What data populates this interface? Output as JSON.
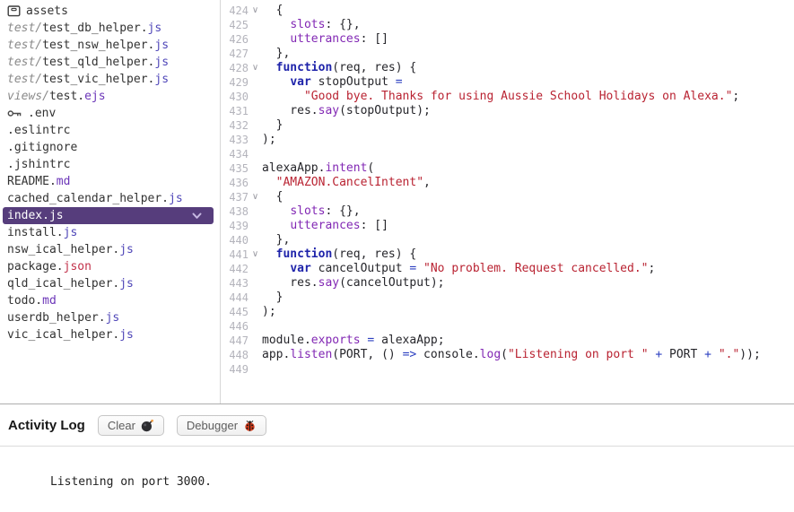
{
  "colors": {
    "selection_bg": "#563d7c",
    "keyword": "#1e23aa",
    "property": "#8228b4",
    "string": "#b92332",
    "operator": "#2b3fc0",
    "ext_js": "#4f46b8",
    "ext_md": "#6b35b8",
    "ext_ejs": "#6b35b8",
    "ext_json": "#c2314a",
    "dir_gray": "#8a8a8a"
  },
  "sidebar": {
    "files": [
      {
        "id": "assets",
        "icon": "archive-box-icon",
        "segments": [
          {
            "t": "assets",
            "c": "name"
          }
        ]
      },
      {
        "id": "test-test_db_helper-js",
        "segments": [
          {
            "t": "test/",
            "c": "dir"
          },
          {
            "t": "test_db_helper.",
            "c": "name"
          },
          {
            "t": "js",
            "c": "ext-js"
          }
        ]
      },
      {
        "id": "test-test_nsw_helper-js",
        "segments": [
          {
            "t": "test/",
            "c": "dir"
          },
          {
            "t": "test_nsw_helper.",
            "c": "name"
          },
          {
            "t": "js",
            "c": "ext-js"
          }
        ]
      },
      {
        "id": "test-test_qld_helper-js",
        "segments": [
          {
            "t": "test/",
            "c": "dir"
          },
          {
            "t": "test_qld_helper.",
            "c": "name"
          },
          {
            "t": "js",
            "c": "ext-js"
          }
        ]
      },
      {
        "id": "test-test_vic_helper-js",
        "segments": [
          {
            "t": "test/",
            "c": "dir"
          },
          {
            "t": "test_vic_helper.",
            "c": "name"
          },
          {
            "t": "js",
            "c": "ext-js"
          }
        ]
      },
      {
        "id": "views-test-ejs",
        "segments": [
          {
            "t": "views/",
            "c": "dir"
          },
          {
            "t": "test.",
            "c": "name"
          },
          {
            "t": "ejs",
            "c": "ext-ejs"
          }
        ]
      },
      {
        "id": "env",
        "icon": "key-icon",
        "segments": [
          {
            "t": ".env",
            "c": "name"
          }
        ]
      },
      {
        "id": "eslintrc",
        "segments": [
          {
            "t": ".eslintrc",
            "c": "name"
          }
        ]
      },
      {
        "id": "gitignore",
        "segments": [
          {
            "t": ".gitignore",
            "c": "name"
          }
        ]
      },
      {
        "id": "jshintrc",
        "segments": [
          {
            "t": ".jshintrc",
            "c": "name"
          }
        ]
      },
      {
        "id": "readme-md",
        "segments": [
          {
            "t": "README.",
            "c": "name"
          },
          {
            "t": "md",
            "c": "ext-md"
          }
        ]
      },
      {
        "id": "cached_calendar_helper-js",
        "segments": [
          {
            "t": "cached_calendar_helper.",
            "c": "name"
          },
          {
            "t": "js",
            "c": "ext-js"
          }
        ]
      },
      {
        "id": "index-js",
        "selected": true,
        "segments": [
          {
            "t": "index.",
            "c": "name"
          },
          {
            "t": "js",
            "c": "ext-js"
          }
        ]
      },
      {
        "id": "install-js",
        "segments": [
          {
            "t": "install.",
            "c": "name"
          },
          {
            "t": "js",
            "c": "ext-js"
          }
        ]
      },
      {
        "id": "nsw_ical_helper-js",
        "segments": [
          {
            "t": "nsw_ical_helper.",
            "c": "name"
          },
          {
            "t": "js",
            "c": "ext-js"
          }
        ]
      },
      {
        "id": "package-json",
        "segments": [
          {
            "t": "package.",
            "c": "name"
          },
          {
            "t": "json",
            "c": "ext-json"
          }
        ]
      },
      {
        "id": "qld_ical_helper-js",
        "segments": [
          {
            "t": "qld_ical_helper.",
            "c": "name"
          },
          {
            "t": "js",
            "c": "ext-js"
          }
        ]
      },
      {
        "id": "todo-md",
        "segments": [
          {
            "t": "todo.",
            "c": "name"
          },
          {
            "t": "md",
            "c": "ext-md"
          }
        ]
      },
      {
        "id": "userdb_helper-js",
        "segments": [
          {
            "t": "userdb_helper.",
            "c": "name"
          },
          {
            "t": "js",
            "c": "ext-js"
          }
        ]
      },
      {
        "id": "vic_ical_helper-js",
        "segments": [
          {
            "t": "vic_ical_helper.",
            "c": "name"
          },
          {
            "t": "js",
            "c": "ext-js"
          }
        ]
      }
    ]
  },
  "editor": {
    "lines": [
      {
        "n": 424,
        "fold": true,
        "tokens": [
          {
            "t": "  {",
            "c": "plain"
          }
        ]
      },
      {
        "n": 425,
        "fold": false,
        "tokens": [
          {
            "t": "    ",
            "c": "plain"
          },
          {
            "t": "slots",
            "c": "property"
          },
          {
            "t": ": {},",
            "c": "plain"
          }
        ]
      },
      {
        "n": 426,
        "fold": false,
        "tokens": [
          {
            "t": "    ",
            "c": "plain"
          },
          {
            "t": "utterances",
            "c": "property"
          },
          {
            "t": ": []",
            "c": "plain"
          }
        ]
      },
      {
        "n": 427,
        "fold": false,
        "tokens": [
          {
            "t": "  },",
            "c": "plain"
          }
        ]
      },
      {
        "n": 428,
        "fold": true,
        "tokens": [
          {
            "t": "  ",
            "c": "plain"
          },
          {
            "t": "function",
            "c": "keyword"
          },
          {
            "t": "(req, res) {",
            "c": "plain"
          }
        ]
      },
      {
        "n": 429,
        "fold": false,
        "tokens": [
          {
            "t": "    ",
            "c": "plain"
          },
          {
            "t": "var",
            "c": "keyword"
          },
          {
            "t": " stopOutput ",
            "c": "plain"
          },
          {
            "t": "=",
            "c": "operator"
          }
        ]
      },
      {
        "n": 430,
        "fold": false,
        "tokens": [
          {
            "t": "      ",
            "c": "plain"
          },
          {
            "t": "\"Good bye. Thanks for using Aussie School Holidays on Alexa.\"",
            "c": "string"
          },
          {
            "t": ";",
            "c": "plain"
          }
        ]
      },
      {
        "n": 431,
        "fold": false,
        "tokens": [
          {
            "t": "    res.",
            "c": "plain"
          },
          {
            "t": "say",
            "c": "property"
          },
          {
            "t": "(stopOutput);",
            "c": "plain"
          }
        ]
      },
      {
        "n": 432,
        "fold": false,
        "tokens": [
          {
            "t": "  }",
            "c": "plain"
          }
        ]
      },
      {
        "n": 433,
        "fold": false,
        "tokens": [
          {
            "t": ");",
            "c": "plain"
          }
        ]
      },
      {
        "n": 434,
        "fold": false,
        "tokens": []
      },
      {
        "n": 435,
        "fold": false,
        "tokens": [
          {
            "t": "alexaApp.",
            "c": "plain"
          },
          {
            "t": "intent",
            "c": "property"
          },
          {
            "t": "(",
            "c": "plain"
          }
        ]
      },
      {
        "n": 436,
        "fold": false,
        "tokens": [
          {
            "t": "  ",
            "c": "plain"
          },
          {
            "t": "\"AMAZON.CancelIntent\"",
            "c": "string"
          },
          {
            "t": ",",
            "c": "plain"
          }
        ]
      },
      {
        "n": 437,
        "fold": true,
        "tokens": [
          {
            "t": "  {",
            "c": "plain"
          }
        ]
      },
      {
        "n": 438,
        "fold": false,
        "tokens": [
          {
            "t": "    ",
            "c": "plain"
          },
          {
            "t": "slots",
            "c": "property"
          },
          {
            "t": ": {},",
            "c": "plain"
          }
        ]
      },
      {
        "n": 439,
        "fold": false,
        "tokens": [
          {
            "t": "    ",
            "c": "plain"
          },
          {
            "t": "utterances",
            "c": "property"
          },
          {
            "t": ": []",
            "c": "plain"
          }
        ]
      },
      {
        "n": 440,
        "fold": false,
        "tokens": [
          {
            "t": "  },",
            "c": "plain"
          }
        ]
      },
      {
        "n": 441,
        "fold": true,
        "tokens": [
          {
            "t": "  ",
            "c": "plain"
          },
          {
            "t": "function",
            "c": "keyword"
          },
          {
            "t": "(req, res) {",
            "c": "plain"
          }
        ]
      },
      {
        "n": 442,
        "fold": false,
        "tokens": [
          {
            "t": "    ",
            "c": "plain"
          },
          {
            "t": "var",
            "c": "keyword"
          },
          {
            "t": " cancelOutput ",
            "c": "plain"
          },
          {
            "t": "=",
            "c": "operator"
          },
          {
            "t": " ",
            "c": "plain"
          },
          {
            "t": "\"No problem. Request cancelled.\"",
            "c": "string"
          },
          {
            "t": ";",
            "c": "plain"
          }
        ]
      },
      {
        "n": 443,
        "fold": false,
        "tokens": [
          {
            "t": "    res.",
            "c": "plain"
          },
          {
            "t": "say",
            "c": "property"
          },
          {
            "t": "(cancelOutput);",
            "c": "plain"
          }
        ]
      },
      {
        "n": 444,
        "fold": false,
        "tokens": [
          {
            "t": "  }",
            "c": "plain"
          }
        ]
      },
      {
        "n": 445,
        "fold": false,
        "tokens": [
          {
            "t": ");",
            "c": "plain"
          }
        ]
      },
      {
        "n": 446,
        "fold": false,
        "tokens": []
      },
      {
        "n": 447,
        "fold": false,
        "tokens": [
          {
            "t": "module.",
            "c": "plain"
          },
          {
            "t": "exports",
            "c": "property"
          },
          {
            "t": " ",
            "c": "plain"
          },
          {
            "t": "=",
            "c": "operator"
          },
          {
            "t": " alexaApp;",
            "c": "plain"
          }
        ]
      },
      {
        "n": 448,
        "fold": false,
        "tokens": [
          {
            "t": "app.",
            "c": "plain"
          },
          {
            "t": "listen",
            "c": "property"
          },
          {
            "t": "(PORT, () ",
            "c": "plain"
          },
          {
            "t": "=>",
            "c": "operator"
          },
          {
            "t": " console.",
            "c": "plain"
          },
          {
            "t": "log",
            "c": "property"
          },
          {
            "t": "(",
            "c": "plain"
          },
          {
            "t": "\"Listening on port \"",
            "c": "string"
          },
          {
            "t": " ",
            "c": "plain"
          },
          {
            "t": "+",
            "c": "operator"
          },
          {
            "t": " PORT ",
            "c": "plain"
          },
          {
            "t": "+",
            "c": "operator"
          },
          {
            "t": " ",
            "c": "plain"
          },
          {
            "t": "\".\"",
            "c": "string"
          },
          {
            "t": "));",
            "c": "plain"
          }
        ]
      },
      {
        "n": 449,
        "fold": false,
        "tokens": []
      }
    ]
  },
  "activity_log": {
    "title": "Activity Log",
    "clear_label": "Clear",
    "clear_icon": "bomb-icon",
    "debugger_label": "Debugger",
    "debugger_icon": "ladybug-icon",
    "log_text": "Listening on port 3000."
  }
}
